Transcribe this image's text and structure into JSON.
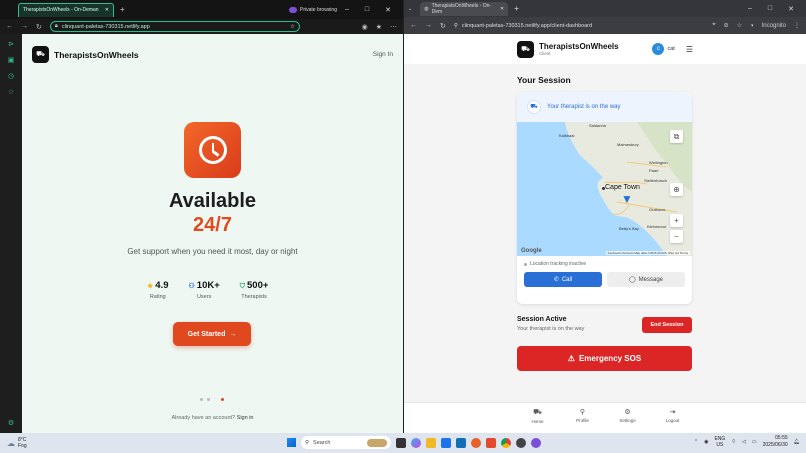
{
  "left_browser": {
    "tab_title": "TherapistsOnWheels - On-Deman",
    "private_label": "Private browsing",
    "url": "clinquant-paletas-730315.netlify.app",
    "page": {
      "brand": "TherapistsOnWheels",
      "sign_in": "Sign In",
      "headline": "Available",
      "headline_accent": "24/7",
      "subtitle": "Get support when you need it most, day or night",
      "stats": [
        {
          "value": "4.9",
          "label": "Rating",
          "icon": "star-icon"
        },
        {
          "value": "10K+",
          "label": "Users",
          "icon": "users-icon"
        },
        {
          "value": "500+",
          "label": "Therapists",
          "icon": "shield-icon"
        }
      ],
      "cta": "Get Started",
      "already_prefix": "Already have an account?",
      "already_link": "Sign in"
    }
  },
  "right_browser": {
    "tab_title": "TherapistsOnWheels - On-Dem",
    "url": "clinquant-paletas-730315.netlify.app/client-dashboard",
    "incognito": "Incognito",
    "page": {
      "brand": "TherapistsOnWheels",
      "brand_sub": "Client",
      "user_initial": "c",
      "user_name": "cat",
      "section_title": "Your Session",
      "status_banner": "Your therapist is on the way",
      "map": {
        "labels": [
          "Kalkbaai",
          "Malmesbury",
          "Saldanha",
          "Wellington",
          "Paarl",
          "Stellenbosch",
          "Grabouw",
          "Betty's Bay",
          "Kleinmond"
        ],
        "city": "Cape Town",
        "google": "Google",
        "shortcuts": "Keyboard shortcuts",
        "attribution": "Map data ©2025 AfriGIS (Pty) Ltd",
        "terms": "Terms"
      },
      "tracking": "Location tracking inactive",
      "call": "Call",
      "message": "Message",
      "session_active": "Session Active",
      "session_sub": "Your therapist is on the way",
      "end_session": "End Session",
      "sos": "Emergency SOS",
      "nav": [
        {
          "label": "Home",
          "icon": "car-icon"
        },
        {
          "label": "Profile",
          "icon": "user-icon"
        },
        {
          "label": "Settings",
          "icon": "gear-icon"
        },
        {
          "label": "Logout",
          "icon": "logout-icon"
        }
      ]
    }
  },
  "taskbar": {
    "temp": "8°C",
    "weather": "Fog",
    "search": "Search",
    "lang": "ENG",
    "region": "US",
    "time": "05:55",
    "date": "2025/06/30"
  },
  "colors": {
    "accent": "#e0481f",
    "blue": "#2a6fd6",
    "danger": "#dc2626"
  }
}
